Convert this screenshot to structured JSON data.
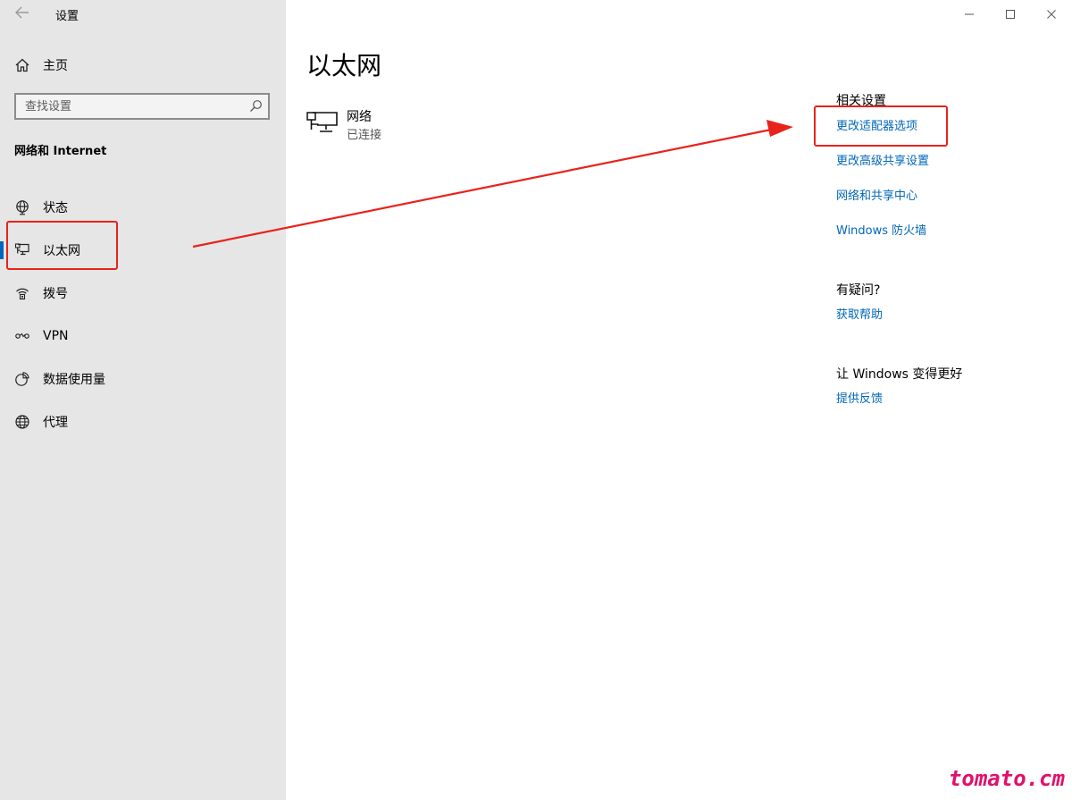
{
  "app": {
    "title": "设置"
  },
  "sidebar": {
    "home_label": "主页",
    "search_placeholder": "查找设置",
    "section_title": "网络和 Internet",
    "items": [
      {
        "label": "状态",
        "icon": "globe-status-icon"
      },
      {
        "label": "以太网",
        "icon": "ethernet-icon",
        "active": true
      },
      {
        "label": "拨号",
        "icon": "dialup-icon"
      },
      {
        "label": "VPN",
        "icon": "vpn-icon"
      },
      {
        "label": "数据使用量",
        "icon": "data-usage-icon"
      },
      {
        "label": "代理",
        "icon": "globe-proxy-icon"
      }
    ]
  },
  "main": {
    "title": "以太网",
    "network": {
      "name": "网络",
      "status": "已连接"
    }
  },
  "related": {
    "heading": "相关设置",
    "links": [
      "更改适配器选项",
      "更改高级共享设置",
      "网络和共享中心",
      "Windows 防火墙"
    ]
  },
  "help": {
    "heading": "有疑问?",
    "link": "获取帮助"
  },
  "feedback": {
    "heading": "让 Windows 变得更好",
    "link": "提供反馈"
  },
  "watermark": "tomato.cm",
  "colors": {
    "link": "#0067b8",
    "accent": "#0067c0",
    "annotation": "#e8231b",
    "watermark": "#e0116b"
  }
}
